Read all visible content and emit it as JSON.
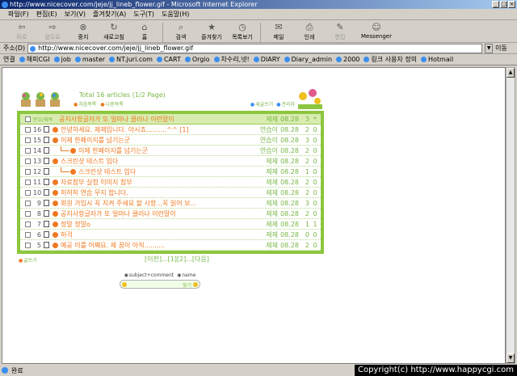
{
  "window": {
    "title": "http://www.nicecover.com/jeje/jj_lineb_flower.gif - Microsoft Internet Explorer"
  },
  "menu": [
    "파일(F)",
    "편집(E)",
    "보기(V)",
    "즐겨찾기(A)",
    "도구(T)",
    "도움말(H)"
  ],
  "toolbar": [
    {
      "label": "뒤로",
      "icon": "back-arrow-icon",
      "enabled": false
    },
    {
      "label": "앞으로",
      "icon": "forward-arrow-icon",
      "enabled": false
    },
    {
      "label": "중지",
      "icon": "stop-icon",
      "enabled": true
    },
    {
      "label": "새로고침",
      "icon": "refresh-icon",
      "enabled": true
    },
    {
      "label": "홈",
      "icon": "home-icon",
      "enabled": true
    },
    {
      "label": "검색",
      "icon": "search-icon",
      "enabled": true
    },
    {
      "label": "즐겨찾기",
      "icon": "favorites-icon",
      "enabled": true
    },
    {
      "label": "목록보기",
      "icon": "history-icon",
      "enabled": true
    },
    {
      "label": "메일",
      "icon": "mail-icon",
      "enabled": true
    },
    {
      "label": "인쇄",
      "icon": "print-icon",
      "enabled": true
    },
    {
      "label": "편집",
      "icon": "edit-icon",
      "enabled": false
    },
    {
      "label": "Messenger",
      "icon": "messenger-icon",
      "enabled": true
    }
  ],
  "address": {
    "label": "주소(D)",
    "value": "http://www.nicecover.com/jeje/jj_lineb_flower.gif",
    "go": "이동"
  },
  "links": {
    "label": "연결",
    "items": [
      "해피CGI",
      "job",
      "master",
      "NT.juri.com",
      "CART",
      "Orgio",
      "차수리,넷!",
      "DIARY",
      "Diary_admin",
      "2000",
      "링크 사용자 정의",
      "Hotmail"
    ]
  },
  "board": {
    "total": "Total 16 articles (1/2 Page)",
    "nav_buttons": [
      "처음목록",
      "나중목록"
    ],
    "top_buttons": [
      "새글쓰기",
      "관리자"
    ],
    "notice": {
      "label": "번호/제목",
      "subject": "공지사항글자가 또 얼마나 클러나 이런말이",
      "name": "제제",
      "date": "08.28",
      "hit": "3",
      "recommend": "*"
    },
    "rows": [
      {
        "num": "16",
        "subject": "안녕하세요. 제제입니다. 아시죠..........^^ [1]",
        "name": "연습이",
        "date": "08.28",
        "hit": "2",
        "rec": "0",
        "reply": false
      },
      {
        "num": "15",
        "subject": "이제 한페이지를 넘기는군",
        "name": "연습이",
        "date": "08.28",
        "hit": "3",
        "rec": "0",
        "reply": false
      },
      {
        "num": "14",
        "subject": "이제 한페이지를 넘기는군",
        "name": "연습이",
        "date": "08.28",
        "hit": "2",
        "rec": "0",
        "reply": true
      },
      {
        "num": "13",
        "subject": "스크린샷 테스트 입다",
        "name": "제제",
        "date": "08.28",
        "hit": "2",
        "rec": "0",
        "reply": false
      },
      {
        "num": "12",
        "subject": "스크린샷 테스트 입다",
        "name": "제제",
        "date": "08.28",
        "hit": "1",
        "rec": "0",
        "reply": true
      },
      {
        "num": "11",
        "subject": "자료첨부 실험 이미지 첨부",
        "name": "제제",
        "date": "08.28",
        "hit": "2",
        "rec": "0",
        "reply": false
      },
      {
        "num": "10",
        "subject": "허허허 연습 무지 합니다.",
        "name": "제제",
        "date": "08.28",
        "hit": "2",
        "rec": "0",
        "reply": false
      },
      {
        "num": "9",
        "subject": "회원 가입시 꼭 지켜 주세요 할 사항...꼭 읽어 보...",
        "name": "제제",
        "date": "08.28",
        "hit": "3",
        "rec": "0",
        "reply": false
      },
      {
        "num": "8",
        "subject": "공지사항글자가 또 얼마나 클러나 이런말이",
        "name": "제제",
        "date": "08.28",
        "hit": "2",
        "rec": "0",
        "reply": false
      },
      {
        "num": "7",
        "subject": "정말 정말o",
        "name": "제제",
        "date": "08.28",
        "hit": "1",
        "rec": "1",
        "reply": false
      },
      {
        "num": "6",
        "subject": "허걱",
        "name": "제제",
        "date": "08.28",
        "hit": "0",
        "rec": "0",
        "reply": false
      },
      {
        "num": "5",
        "subject": "예공 이를 어째요. 제 꿈이 아직..........",
        "name": "제제",
        "date": "08.28",
        "hit": "2",
        "rec": "0",
        "reply": false
      }
    ],
    "write_label": "글쓰기",
    "pager": "[이전]...[1][2]...[다음]",
    "search": {
      "options": [
        "subject+comment",
        "name"
      ],
      "go": "찾기"
    }
  },
  "status": {
    "text": "완료"
  },
  "copyright": "Copyright(c) http://www.happycgi.com"
}
